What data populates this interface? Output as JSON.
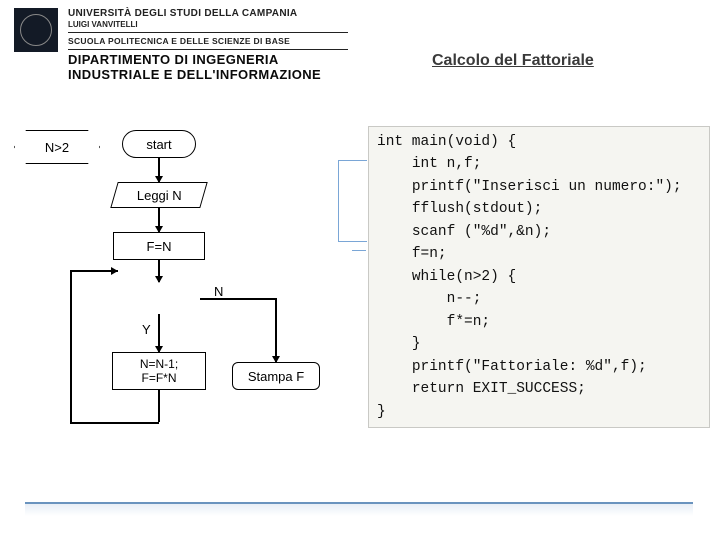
{
  "header": {
    "uni_name": "UNIVERSITÀ DEGLI STUDI DELLA CAMPANIA",
    "luigi": "LUIGI VANVITELLI",
    "scuola": "SCUOLA POLITECNICA E DELLE SCIENZE DI BASE",
    "dept_line1": "DIPARTIMENTO DI INGEGNERIA",
    "dept_line2": "INDUSTRIALE E DELL'INFORMAZIONE"
  },
  "title": "Calcolo del Fattoriale",
  "flowchart": {
    "start": "start",
    "read": "Leggi N",
    "init": "F=N",
    "cond": "N>2",
    "cond_no": "N",
    "cond_yes": "Y",
    "update_line1": "N=N-1;",
    "update_line2": "F=F*N",
    "print": "Stampa F"
  },
  "code": {
    "l1": "int main(void) {",
    "l2": "    int n,f;",
    "l3": "    printf(\"Inserisci un numero:\");",
    "l4": "    fflush(stdout);",
    "l5": "    scanf (\"%d\",&n);",
    "l6": "    f=n;",
    "l7": "    while(n>2) {",
    "l8": "        n--;",
    "l9": "        f*=n;",
    "l10": "    }",
    "l11": "    printf(\"Fattoriale: %d\",f);",
    "l12": "    return EXIT_SUCCESS;",
    "l13": "}"
  }
}
